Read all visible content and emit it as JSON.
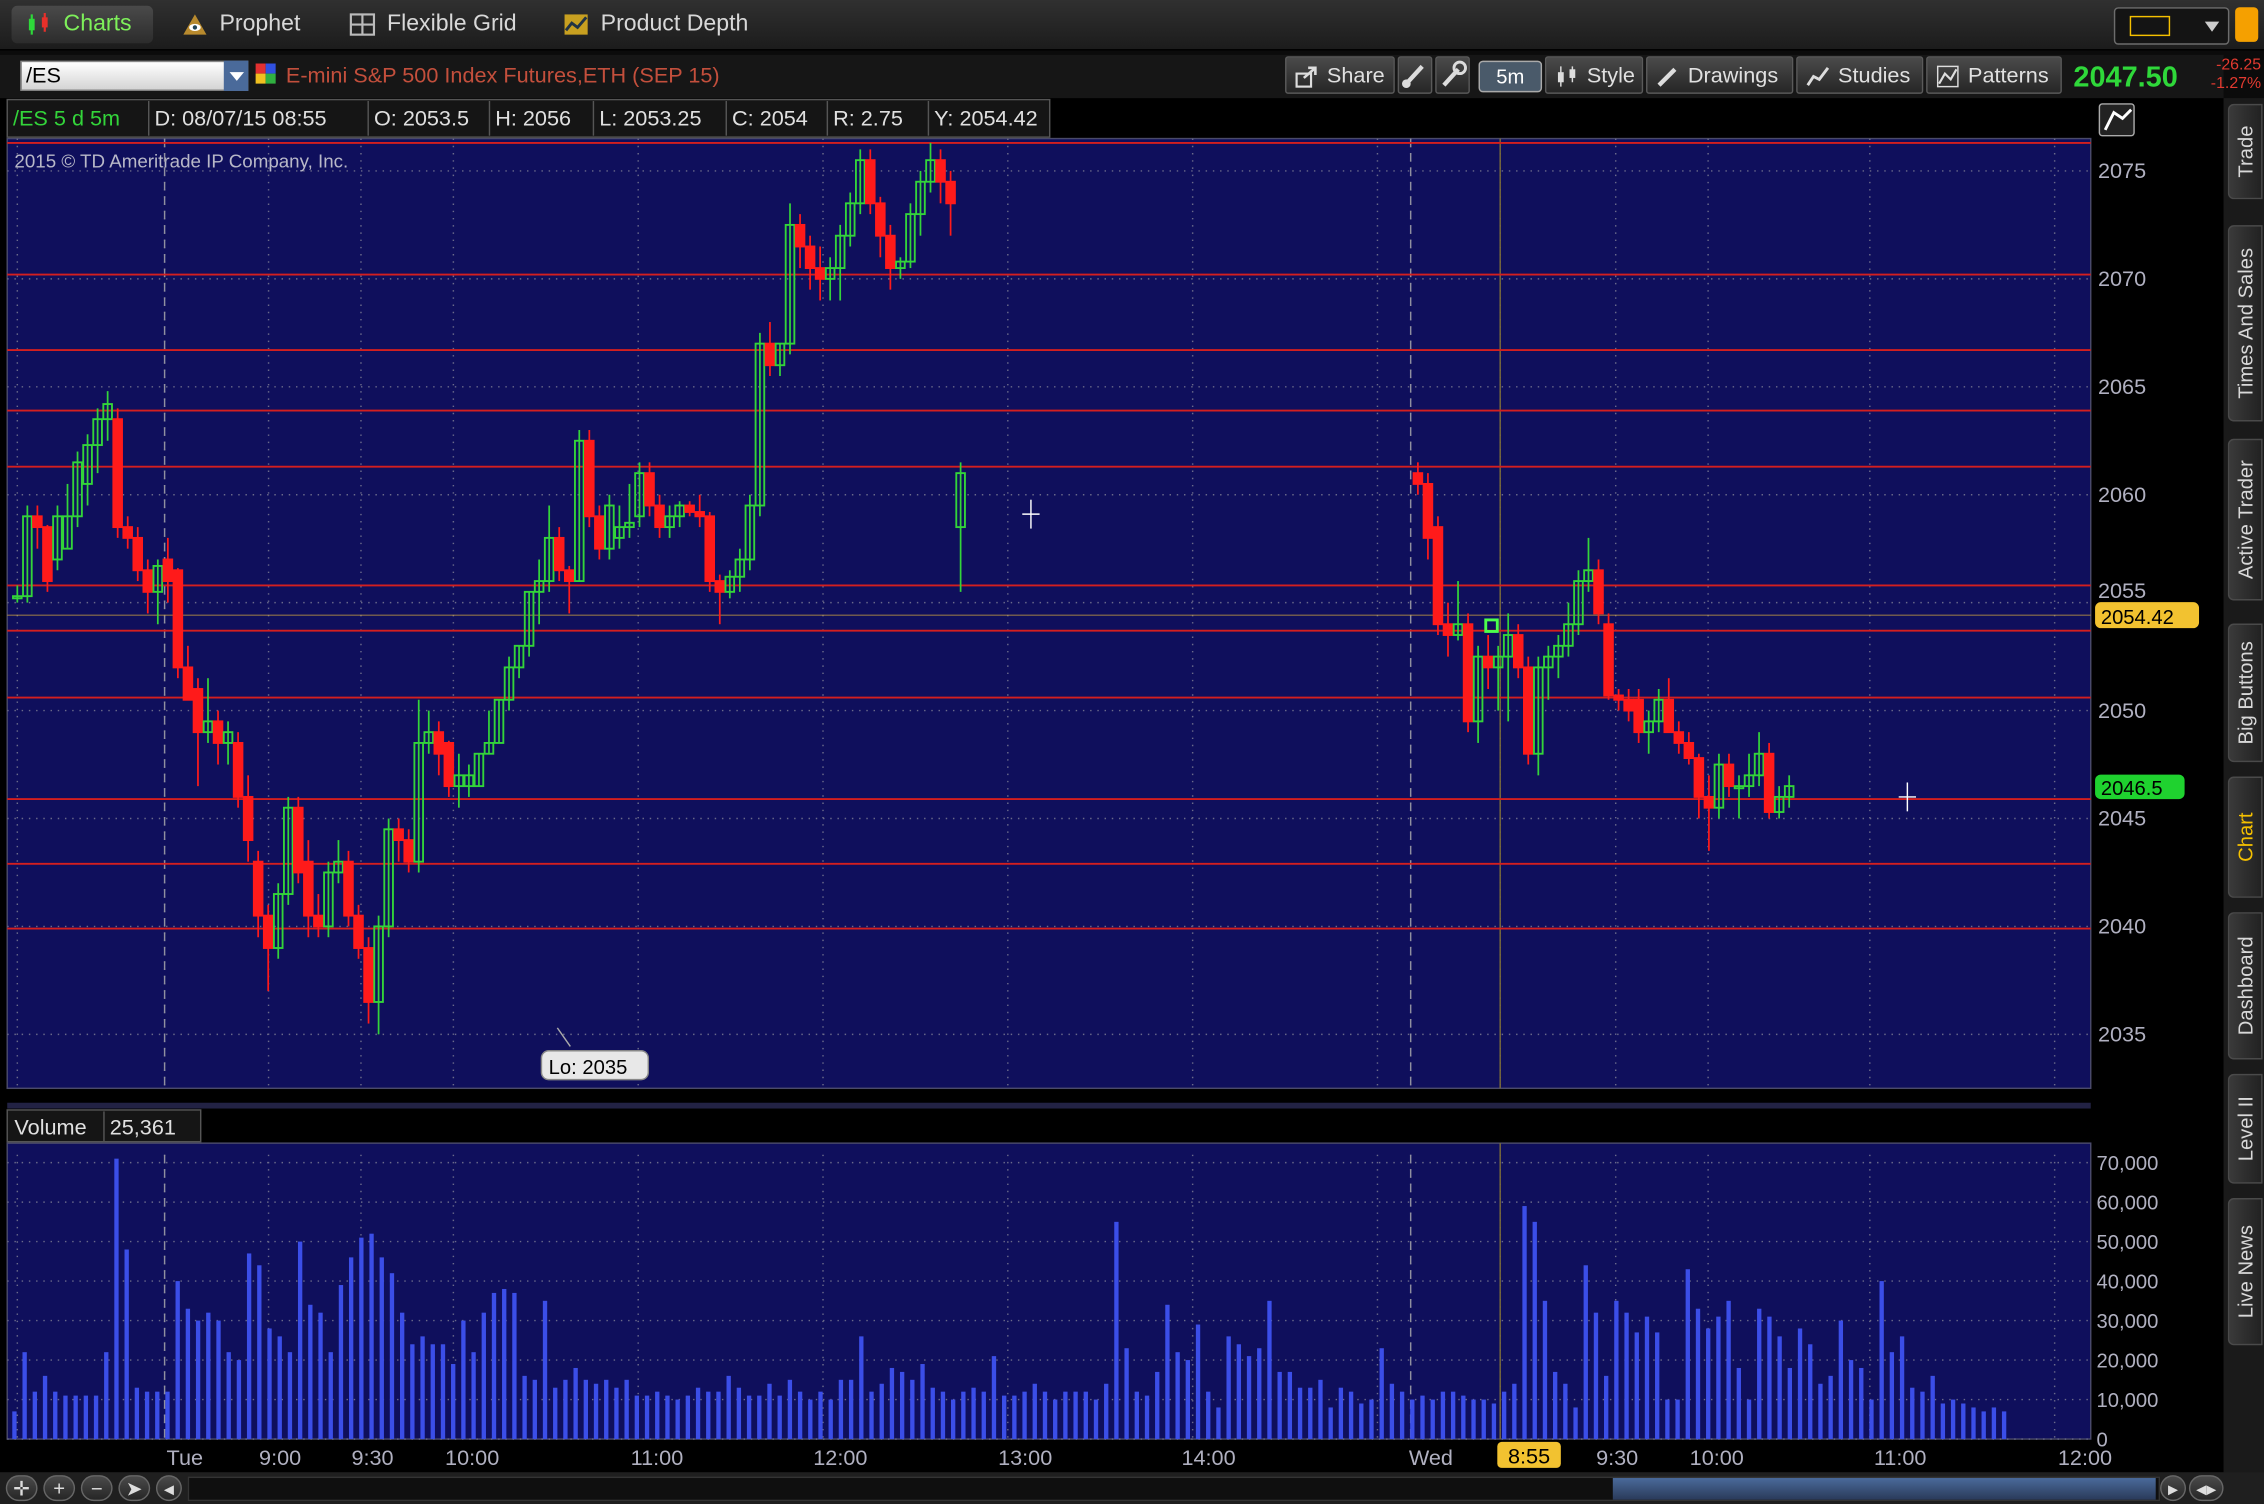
{
  "app_tabs": [
    {
      "label": "Charts",
      "icon": "charts-icon",
      "active": true
    },
    {
      "label": "Prophet",
      "icon": "prophet-eye-icon",
      "active": false
    },
    {
      "label": "Flexible Grid",
      "icon": "grid-icon",
      "active": false
    },
    {
      "label": "Product Depth",
      "icon": "depth-icon",
      "active": false
    }
  ],
  "toolbar": {
    "symbol": "/ES",
    "description": "E-mini S&P 500 Index Futures,ETH (SEP 15)",
    "share_label": "Share",
    "aggregation": "5m",
    "style_label": "Style",
    "drawings_label": "Drawings",
    "studies_label": "Studies",
    "patterns_label": "Patterns",
    "last_price": "2047.50",
    "net_change": "-26.25",
    "net_change_pct": "-1.27%"
  },
  "header": {
    "fields": [
      "/ES 5 d 5m",
      "D: 08/07/15 08:55",
      "O: 2053.5",
      "H: 2056",
      "L: 2053.25",
      "C: 2054",
      "R: 2.75",
      "Y: 2054.42"
    ],
    "copyright": "2015 © TD Ameritrade IP Company, Inc."
  },
  "volume_header": {
    "label": "Volume",
    "value": "25,361"
  },
  "right_tabs": [
    "Trade",
    "Times And Sales",
    "Active Trader",
    "Big Buttons",
    "Chart",
    "Dashboard",
    "Level II",
    "Live News"
  ],
  "active_right_tab": "Chart",
  "colors": {
    "background": "#0f0f5c",
    "grid": "#6a6a8a",
    "up": "#33d43a",
    "down": "#ff1a1a",
    "level_line": "#d41f1f",
    "volume": "#3b4ee8",
    "price_bubble_yellow": "#f2c230",
    "price_bubble_green": "#1fd22f"
  },
  "chart_data": {
    "type": "candlestick",
    "symbol": "/ES",
    "period": "5 d",
    "interval": "5m",
    "ylim": [
      2032.5,
      2076.5
    ],
    "yticks": [
      2075,
      2070,
      2065,
      2060,
      2055,
      2050,
      2045,
      2040,
      2035
    ],
    "ytick_labels": [
      "2075",
      "2070",
      "2065",
      "2060",
      "2050",
      "2045",
      "2040",
      "2035"
    ],
    "y_partial_label": "2055",
    "level_lines": [
      2076.3,
      2070.2,
      2066.7,
      2063.9,
      2061.3,
      2055.8,
      2053.7,
      2050.6,
      2045.9,
      2042.9,
      2039.9
    ],
    "last_close_bubble": "2046.5",
    "prev_close_bubble": "2054.42",
    "low_annotation": "Lo: 2035",
    "x_labels": [
      "Tue",
      "9:00",
      "9:30",
      "10:00",
      "11:00",
      "12:00",
      "13:00",
      "14:00",
      "Wed",
      "8:55",
      "9:30",
      "10:00",
      "11:00",
      "12:00"
    ],
    "highlighted_x_label": "8:55",
    "session_break_label": "Wed",
    "candles": [
      [
        2055.3,
        2055.8,
        2055.0,
        2055.3
      ],
      [
        2055.3,
        2059.5,
        2055.0,
        2059.0
      ],
      [
        2059.0,
        2059.5,
        2057.5,
        2058.5
      ],
      [
        2058.5,
        2058.6,
        2055.5,
        2056.0
      ],
      [
        2057.0,
        2059.5,
        2056.5,
        2059.0
      ],
      [
        2057.5,
        2060.5,
        2057.5,
        2059.0
      ],
      [
        2059.0,
        2062.0,
        2058.5,
        2061.5
      ],
      [
        2060.5,
        2062.8,
        2059.5,
        2062.3
      ],
      [
        2062.3,
        2064.0,
        2061.0,
        2063.5
      ],
      [
        2063.5,
        2064.8,
        2062.5,
        2064.2
      ],
      [
        2063.5,
        2064.0,
        2058.0,
        2058.5
      ],
      [
        2058.5,
        2059.0,
        2057.5,
        2058.0
      ],
      [
        2058.0,
        2058.5,
        2056.0,
        2056.5
      ],
      [
        2056.5,
        2057.0,
        2054.5,
        2055.5
      ],
      [
        2055.5,
        2057.0,
        2054.0,
        2056.7
      ],
      [
        2057.0,
        2058.0,
        2055.0,
        2056.0
      ],
      [
        2056.5,
        2056.6,
        2051.5,
        2052.0
      ],
      [
        2052.0,
        2053.0,
        2050.5,
        2050.5
      ],
      [
        2051.0,
        2051.5,
        2046.5,
        2049.0
      ],
      [
        2049.0,
        2051.5,
        2048.5,
        2049.5
      ],
      [
        2049.5,
        2050.0,
        2047.5,
        2048.5
      ],
      [
        2048.5,
        2049.5,
        2047.5,
        2049.0
      ],
      [
        2048.5,
        2049.0,
        2045.5,
        2046.0
      ],
      [
        2046.0,
        2047.0,
        2043.0,
        2044.0
      ],
      [
        2043.0,
        2043.5,
        2039.5,
        2040.5
      ],
      [
        2040.5,
        2041.0,
        2037.0,
        2039.0
      ],
      [
        2039.0,
        2042.0,
        2038.5,
        2041.5
      ],
      [
        2041.5,
        2046.0,
        2041.0,
        2045.5
      ],
      [
        2045.5,
        2046.0,
        2042.0,
        2042.5
      ],
      [
        2043.0,
        2044.0,
        2039.5,
        2040.5
      ],
      [
        2040.5,
        2041.5,
        2039.5,
        2040.0
      ],
      [
        2040.0,
        2043.0,
        2039.5,
        2042.5
      ],
      [
        2042.5,
        2044.0,
        2042.0,
        2043.0
      ],
      [
        2043.0,
        2043.5,
        2040.0,
        2040.5
      ],
      [
        2040.5,
        2041.0,
        2038.5,
        2039.0
      ],
      [
        2039.0,
        2039.5,
        2035.5,
        2036.5
      ],
      [
        2036.5,
        2040.5,
        2035.0,
        2040.0
      ],
      [
        2040.0,
        2045.0,
        2039.5,
        2044.5
      ],
      [
        2044.5,
        2045.0,
        2043.0,
        2044.0
      ],
      [
        2044.0,
        2044.5,
        2042.5,
        2043.0
      ],
      [
        2043.0,
        2050.5,
        2042.5,
        2048.5
      ],
      [
        2048.5,
        2050.0,
        2048.0,
        2049.0
      ],
      [
        2049.0,
        2049.5,
        2047.0,
        2048.0
      ],
      [
        2048.5,
        2048.6,
        2046.0,
        2046.5
      ],
      [
        2046.5,
        2048.0,
        2045.5,
        2047.0
      ],
      [
        2046.5,
        2047.5,
        2046.0,
        2047.0
      ],
      [
        2046.5,
        2048.0,
        2046.5,
        2048.0
      ],
      [
        2048.0,
        2050.0,
        2048.0,
        2048.5
      ],
      [
        2048.5,
        2050.5,
        2048.5,
        2050.5
      ],
      [
        2050.5,
        2052.5,
        2050.0,
        2052.0
      ],
      [
        2052.0,
        2053.0,
        2051.5,
        2053.0
      ],
      [
        2053.0,
        2055.5,
        2052.5,
        2055.5
      ],
      [
        2055.5,
        2057.0,
        2054.0,
        2056.0
      ],
      [
        2056.0,
        2059.5,
        2055.5,
        2058.0
      ],
      [
        2058.0,
        2058.5,
        2056.0,
        2056.5
      ],
      [
        2056.5,
        2056.7,
        2054.5,
        2056.0
      ],
      [
        2056.0,
        2063.0,
        2056.0,
        2062.5
      ],
      [
        2062.5,
        2063.0,
        2058.5,
        2059.0
      ],
      [
        2059.0,
        2059.5,
        2057.0,
        2057.5
      ],
      [
        2057.5,
        2060.0,
        2057.0,
        2059.5
      ],
      [
        2058.0,
        2059.5,
        2057.5,
        2058.5
      ],
      [
        2058.5,
        2060.5,
        2058.0,
        2058.7
      ],
      [
        2059.0,
        2061.5,
        2058.5,
        2061.0
      ],
      [
        2061.0,
        2061.5,
        2059.0,
        2059.5
      ],
      [
        2059.5,
        2060.0,
        2058.0,
        2058.5
      ],
      [
        2058.5,
        2059.5,
        2058.0,
        2059.0
      ],
      [
        2059.0,
        2059.7,
        2058.5,
        2059.5
      ],
      [
        2059.5,
        2059.7,
        2059.0,
        2059.2
      ],
      [
        2059.2,
        2060.0,
        2058.5,
        2059.0
      ],
      [
        2059.0,
        2059.2,
        2055.5,
        2056.0
      ],
      [
        2056.0,
        2056.3,
        2054.0,
        2055.5
      ],
      [
        2055.5,
        2056.5,
        2055.2,
        2056.2
      ],
      [
        2056.2,
        2057.5,
        2055.5,
        2057.0
      ],
      [
        2057.0,
        2060.0,
        2056.5,
        2059.5
      ],
      [
        2059.5,
        2067.5,
        2059.0,
        2067.0
      ],
      [
        2067.0,
        2068.0,
        2065.5,
        2066.0
      ],
      [
        2066.0,
        2067.0,
        2065.5,
        2067.0
      ],
      [
        2067.0,
        2073.5,
        2066.5,
        2072.5
      ],
      [
        2072.5,
        2073.0,
        2070.5,
        2071.5
      ],
      [
        2071.5,
        2072.0,
        2069.5,
        2070.5
      ],
      [
        2070.5,
        2071.5,
        2069.0,
        2070.0
      ],
      [
        2070.0,
        2071.0,
        2069.0,
        2070.5
      ],
      [
        2070.5,
        2072.5,
        2069.0,
        2072.0
      ],
      [
        2072.0,
        2074.0,
        2071.5,
        2073.5
      ],
      [
        2073.5,
        2076.0,
        2073.0,
        2075.5
      ],
      [
        2075.5,
        2076.0,
        2073.0,
        2073.5
      ],
      [
        2073.5,
        2073.8,
        2071.0,
        2072.0
      ],
      [
        2072.0,
        2072.5,
        2069.5,
        2070.5
      ],
      [
        2070.5,
        2071.0,
        2070.0,
        2070.8
      ],
      [
        2070.8,
        2073.5,
        2070.5,
        2073.0
      ],
      [
        2073.0,
        2075.0,
        2072.0,
        2074.5
      ],
      [
        2074.5,
        2076.3,
        2074.0,
        2075.5
      ],
      [
        2075.5,
        2076.0,
        2073.5,
        2074.5
      ],
      [
        2074.5,
        2075.0,
        2072.0,
        2073.5
      ],
      [
        2058.5,
        2061.5,
        2055.5,
        2061.0
      ],
      [
        2061.0,
        2061.5,
        2060.0,
        2060.5
      ],
      [
        2060.5,
        2061.0,
        2057.0,
        2058.0
      ],
      [
        2058.5,
        2059.0,
        2053.5,
        2054.0
      ],
      [
        2054.0,
        2055.0,
        2052.5,
        2053.5
      ],
      [
        2053.5,
        2056.0,
        2053.25,
        2054.0
      ],
      [
        2054.0,
        2054.5,
        2049.0,
        2049.5
      ],
      [
        2049.5,
        2053.0,
        2048.5,
        2052.5
      ],
      [
        2052.5,
        2053.5,
        2051.0,
        2052.0
      ],
      [
        2052.0,
        2053.0,
        2050.0,
        2052.5
      ],
      [
        2052.5,
        2054.5,
        2049.5,
        2053.5
      ],
      [
        2053.5,
        2054.0,
        2051.5,
        2052.0
      ],
      [
        2052.0,
        2052.5,
        2047.5,
        2048.0
      ],
      [
        2048.0,
        2052.5,
        2047.0,
        2052.0
      ],
      [
        2052.0,
        2053.0,
        2050.5,
        2052.5
      ],
      [
        2052.5,
        2053.5,
        2051.5,
        2053.0
      ],
      [
        2053.0,
        2055.0,
        2052.5,
        2054.0
      ],
      [
        2054.0,
        2056.5,
        2053.5,
        2056.0
      ],
      [
        2056.0,
        2058.0,
        2055.5,
        2056.5
      ],
      [
        2056.5,
        2057.0,
        2054.0,
        2054.5
      ],
      [
        2054.0,
        2054.5,
        2050.5,
        2050.7
      ],
      [
        2050.7,
        2051.0,
        2050.0,
        2050.5
      ],
      [
        2050.5,
        2051.0,
        2049.5,
        2050.0
      ],
      [
        2050.5,
        2051.0,
        2048.5,
        2049.0
      ],
      [
        2049.0,
        2050.0,
        2048.0,
        2049.5
      ],
      [
        2049.5,
        2051.0,
        2049.0,
        2050.5
      ],
      [
        2050.5,
        2051.5,
        2049.0,
        2049.0
      ],
      [
        2049.0,
        2049.5,
        2048.0,
        2048.5
      ],
      [
        2048.5,
        2049.0,
        2047.5,
        2047.8
      ],
      [
        2047.8,
        2048.0,
        2045.0,
        2046.0
      ],
      [
        2046.0,
        2047.0,
        2043.5,
        2045.5
      ],
      [
        2045.5,
        2048.0,
        2045.0,
        2047.5
      ],
      [
        2047.5,
        2048.0,
        2046.0,
        2046.5
      ],
      [
        2046.5,
        2047.0,
        2045.0,
        2046.5
      ],
      [
        2046.5,
        2048.0,
        2046.0,
        2047.0
      ],
      [
        2047.0,
        2049.0,
        2046.5,
        2048.0
      ],
      [
        2048.0,
        2048.5,
        2045.0,
        2045.3
      ],
      [
        2045.3,
        2046.5,
        2045.0,
        2046.0
      ],
      [
        2046.0,
        2047.0,
        2045.5,
        2046.5
      ]
    ],
    "volume": {
      "ylim": [
        0,
        72000
      ],
      "yticks": [
        70000,
        60000,
        50000,
        40000,
        30000,
        20000,
        10000,
        0
      ],
      "ytick_labels": [
        "70,000",
        "60,000",
        "50,000",
        "40,000",
        "30,000",
        "20,000",
        "10,000",
        "0"
      ],
      "values": [
        7000,
        22000,
        12000,
        16000,
        12000,
        11000,
        11000,
        11000,
        11000,
        22000,
        71000,
        48000,
        13000,
        12000,
        12000,
        12000,
        40000,
        33000,
        30000,
        32000,
        30000,
        22000,
        20000,
        47000,
        44000,
        28000,
        26000,
        22000,
        50000,
        34000,
        32000,
        22000,
        39000,
        46000,
        51000,
        52000,
        46000,
        42000,
        32000,
        24000,
        26000,
        24000,
        24000,
        19000,
        30000,
        22000,
        32000,
        37000,
        38000,
        37000,
        16000,
        15000,
        35000,
        13000,
        15000,
        18000,
        15000,
        14000,
        15000,
        13000,
        15000,
        11000,
        11000,
        12000,
        11000,
        10000,
        11000,
        13000,
        12000,
        12000,
        16000,
        13000,
        11000,
        11000,
        14000,
        11000,
        15000,
        12000,
        10000,
        12000,
        10000,
        15000,
        15000,
        26000,
        12000,
        14000,
        18000,
        17000,
        15000,
        19000,
        13000,
        12000,
        10000,
        12000,
        13000,
        12000,
        21000,
        11000,
        11000,
        12000,
        14000,
        12000,
        10000,
        12000,
        12000,
        12000,
        10000,
        14000,
        55000,
        23000,
        12000,
        11000,
        17000,
        34000,
        22000,
        20000,
        29000,
        12000,
        8000,
        26000,
        24000,
        21000,
        23000,
        35000,
        17000,
        17000,
        13000,
        13000,
        15000,
        8000,
        13000,
        12000,
        9000,
        10000,
        23000,
        14000,
        12000,
        10000,
        11000,
        10000,
        12000,
        12000,
        11000,
        10000,
        10000,
        9000,
        12000,
        14000,
        59000,
        55000,
        35000,
        17000,
        14000,
        8000,
        44000,
        32000,
        16000,
        35000,
        32000,
        27000,
        31000,
        27000,
        10000,
        10000,
        43000,
        33000,
        28000,
        31000,
        35000,
        18000,
        10000,
        33000,
        31000,
        26000,
        18000,
        28000,
        24000,
        14000,
        16000,
        30000,
        20000,
        18000,
        10000,
        40000,
        22000,
        26000,
        13000,
        12000,
        16000,
        9000,
        10000,
        9000,
        8000,
        7000,
        8000,
        7000
      ]
    }
  }
}
